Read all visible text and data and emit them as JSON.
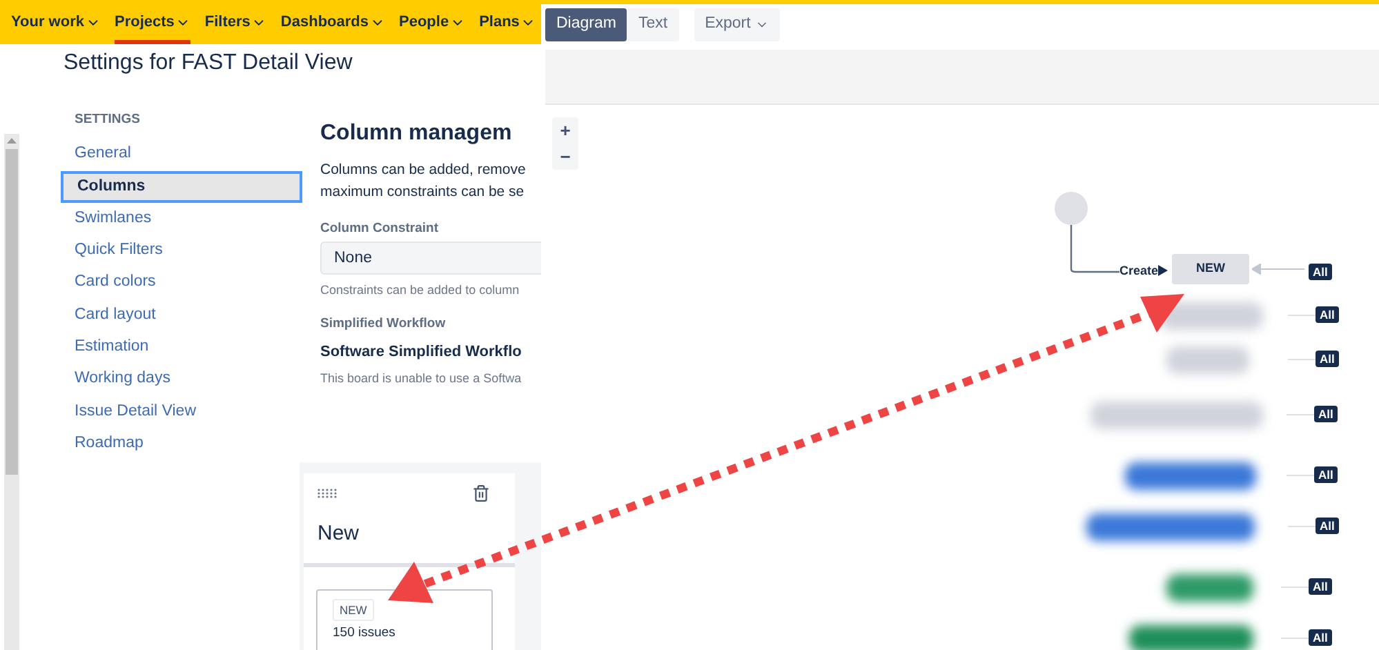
{
  "nav": {
    "items": [
      {
        "label": "Your work",
        "selected": false
      },
      {
        "label": "Projects",
        "selected": true
      },
      {
        "label": "Filters",
        "selected": false
      },
      {
        "label": "Dashboards",
        "selected": false
      },
      {
        "label": "People",
        "selected": false
      },
      {
        "label": "Plans",
        "selected": false
      }
    ]
  },
  "page_title": "Settings for FAST Detail View",
  "sidebar": {
    "heading": "SETTINGS",
    "items": [
      {
        "label": "General",
        "selected": false
      },
      {
        "label": "Columns",
        "selected": true
      },
      {
        "label": "Swimlanes",
        "selected": false
      },
      {
        "label": "Quick Filters",
        "selected": false
      },
      {
        "label": "Card colors",
        "selected": false
      },
      {
        "label": "Card layout",
        "selected": false
      },
      {
        "label": "Estimation",
        "selected": false
      },
      {
        "label": "Working days",
        "selected": false
      },
      {
        "label": "Issue Detail View",
        "selected": false
      },
      {
        "label": "Roadmap",
        "selected": false
      }
    ]
  },
  "content": {
    "heading": "Column managem",
    "description_lines": [
      "Columns can be added, remove",
      "maximum constraints can be se"
    ],
    "constraint_label": "Column Constraint",
    "constraint_value": "None",
    "constraint_hint": "Constraints can be added to column",
    "workflow_label": "Simplified Workflow",
    "workflow_name": "Software Simplified Workflo",
    "workflow_note": "This board is unable to use a Softwa"
  },
  "column_card": {
    "title": "New",
    "status": "NEW",
    "count": "150 issues"
  },
  "diagram": {
    "tabs": [
      {
        "label": "Diagram",
        "selected": true
      },
      {
        "label": "Text",
        "selected": false
      }
    ],
    "export": "Export",
    "zoom_in": "+",
    "zoom_out": "−",
    "transition": "Create",
    "node": "NEW",
    "blurred_nodes": [
      {
        "color": "#d0d3db"
      },
      {
        "color": "#d0d3db"
      },
      {
        "color": "#d0d3db"
      },
      {
        "color": "#3b78d8"
      },
      {
        "color": "#3b78d8"
      },
      {
        "color": "#2e9a68"
      },
      {
        "color": "#1f8f5a"
      }
    ],
    "badges": [
      "All",
      "All",
      "All",
      "All",
      "All",
      "All",
      "All",
      "All"
    ]
  }
}
